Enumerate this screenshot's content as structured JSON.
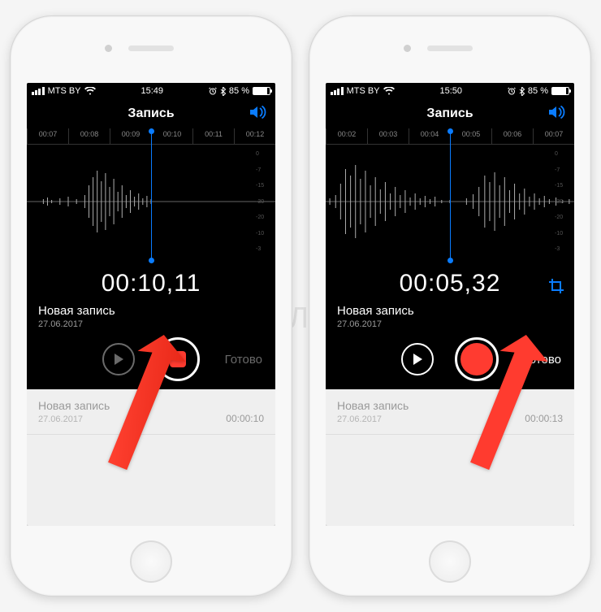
{
  "watermark": "ЯБЛЫК",
  "left": {
    "status": {
      "carrier": "MTS BY",
      "time": "15:49",
      "battery": "85 %"
    },
    "title": "Запись",
    "ruler": [
      "00:07",
      "00:08",
      "00:09",
      "00:10",
      "00:11",
      "00:12"
    ],
    "scale": [
      "0",
      "-3",
      "-7",
      "-10",
      "-15",
      "-20",
      "-30",
      "-30",
      "-20",
      "-15",
      "-10",
      "-7",
      "-3",
      "0"
    ],
    "timer": "00:10,11",
    "rec": {
      "name": "Новая запись",
      "date": "27.06.2017"
    },
    "done": "Готово",
    "state": "recording",
    "listItem": {
      "name": "Новая запись",
      "date": "27.06.2017",
      "dur": "00:00:10"
    }
  },
  "right": {
    "status": {
      "carrier": "MTS BY",
      "time": "15:50",
      "battery": "85 %"
    },
    "title": "Запись",
    "ruler": [
      "00:02",
      "00:03",
      "00:04",
      "00:05",
      "00:06",
      "00:07"
    ],
    "scale": [
      "0",
      "-3",
      "-7",
      "-10",
      "-15",
      "-20",
      "-30",
      "-30",
      "-20",
      "-15",
      "-10",
      "-7",
      "-3",
      "0"
    ],
    "timer": "00:05,32",
    "rec": {
      "name": "Новая запись",
      "date": "27.06.2017"
    },
    "done": "Готово",
    "state": "paused",
    "listItem": {
      "name": "Новая запись",
      "date": "27.06.2017",
      "dur": "00:00:13"
    }
  }
}
